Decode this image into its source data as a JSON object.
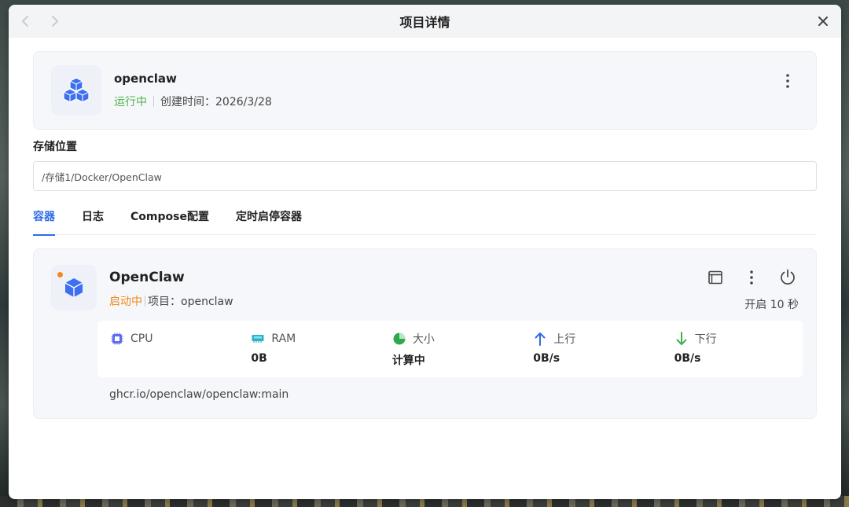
{
  "window": {
    "title": "项目详情"
  },
  "project": {
    "name": "openclaw",
    "status": "运行中",
    "created": "创建时间：2026/3/28"
  },
  "storage": {
    "label": "存储位置",
    "value": "/存储1/Docker/OpenClaw"
  },
  "tabs": [
    {
      "label": "容器",
      "active": true
    },
    {
      "label": "日志",
      "active": false
    },
    {
      "label": "Compose配置",
      "active": false
    },
    {
      "label": "定时启停容器",
      "active": false
    }
  ],
  "container": {
    "name": "OpenClaw",
    "status": "启动中",
    "project": "项目：openclaw",
    "uptime": "开启 10 秒",
    "image": "ghcr.io/openclaw/openclaw:main",
    "stats": [
      {
        "label": "CPU",
        "value": "",
        "icon": "cpu-icon"
      },
      {
        "label": "RAM",
        "value": "0B",
        "icon": "ram-icon"
      },
      {
        "label": "大小",
        "value": "计算中",
        "icon": "pie-chart-icon"
      },
      {
        "label": "上行",
        "value": "0B/s",
        "icon": "arrow-up-icon"
      },
      {
        "label": "下行",
        "value": "0B/s",
        "icon": "arrow-down-icon"
      }
    ]
  },
  "colors": {
    "accent": "#2f6ae6",
    "running": "#4fb34a",
    "starting": "#f08a1c"
  }
}
